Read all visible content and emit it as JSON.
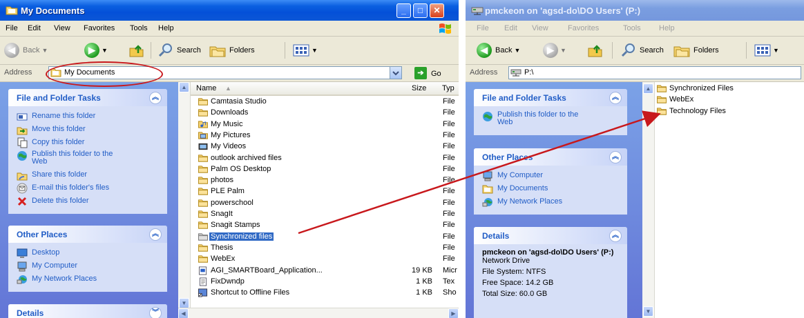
{
  "left_window": {
    "title": "My Documents",
    "menu": [
      "File",
      "Edit",
      "View",
      "Favorites",
      "Tools",
      "Help"
    ],
    "toolbar": {
      "back": "Back",
      "search": "Search",
      "folders": "Folders"
    },
    "address_label": "Address",
    "address_value": "My Documents",
    "go_label": "Go",
    "tasks_title": "File and Folder Tasks",
    "tasks": [
      {
        "label": "Rename this folder",
        "icon": "rename-icon"
      },
      {
        "label": "Move this folder",
        "icon": "move-icon"
      },
      {
        "label": "Copy this folder",
        "icon": "copy-icon"
      },
      {
        "label": "Publish this folder to the Web",
        "icon": "publish-web-icon"
      },
      {
        "label": "Share this folder",
        "icon": "share-icon"
      },
      {
        "label": "E-mail this folder's files",
        "icon": "email-icon"
      },
      {
        "label": "Delete this folder",
        "icon": "delete-icon"
      }
    ],
    "other_title": "Other Places",
    "other": [
      {
        "label": "Desktop",
        "icon": "desktop-icon"
      },
      {
        "label": "My Computer",
        "icon": "my-computer-icon"
      },
      {
        "label": "My Network Places",
        "icon": "network-places-icon"
      }
    ],
    "details_title": "Details",
    "columns": {
      "name": "Name",
      "size": "Size",
      "type": "Typ"
    },
    "files": [
      {
        "name": "Camtasia Studio",
        "size": "",
        "type": "File",
        "icon": "folder"
      },
      {
        "name": "Downloads",
        "size": "",
        "type": "File",
        "icon": "folder"
      },
      {
        "name": "My Music",
        "size": "",
        "type": "File",
        "icon": "music-folder"
      },
      {
        "name": "My Pictures",
        "size": "",
        "type": "File",
        "icon": "pictures-folder"
      },
      {
        "name": "My Videos",
        "size": "",
        "type": "File",
        "icon": "videos-folder"
      },
      {
        "name": "outlook archived files",
        "size": "",
        "type": "File",
        "icon": "folder"
      },
      {
        "name": "Palm OS Desktop",
        "size": "",
        "type": "File",
        "icon": "folder"
      },
      {
        "name": "photos",
        "size": "",
        "type": "File",
        "icon": "folder"
      },
      {
        "name": "PLE Palm",
        "size": "",
        "type": "File",
        "icon": "folder"
      },
      {
        "name": "powerschool",
        "size": "",
        "type": "File",
        "icon": "folder"
      },
      {
        "name": "SnagIt",
        "size": "",
        "type": "File",
        "icon": "folder"
      },
      {
        "name": "Snagit Stamps",
        "size": "",
        "type": "File",
        "icon": "folder"
      },
      {
        "name": "Synchronized files",
        "size": "",
        "type": "File",
        "icon": "sync-folder",
        "selected": true
      },
      {
        "name": "Thesis",
        "size": "",
        "type": "File",
        "icon": "folder"
      },
      {
        "name": "WebEx",
        "size": "",
        "type": "File",
        "icon": "folder"
      },
      {
        "name": "AGI_SMARTBoard_Application...",
        "size": "19 KB",
        "type": "Micr",
        "icon": "document"
      },
      {
        "name": "FixDwndp",
        "size": "1 KB",
        "type": "Tex",
        "icon": "text-file"
      },
      {
        "name": "Shortcut to Offline Files",
        "size": "1 KB",
        "type": "Sho",
        "icon": "shortcut"
      }
    ]
  },
  "right_window": {
    "title": "pmckeon on 'agsd-do\\DO Users' (P:)",
    "menu": [
      "File",
      "Edit",
      "View",
      "Favorites",
      "Tools",
      "Help"
    ],
    "toolbar": {
      "back": "Back",
      "search": "Search",
      "folders": "Folders"
    },
    "address_label": "Address",
    "address_value": "P:\\",
    "tasks_title": "File and Folder Tasks",
    "tasks": [
      {
        "label": "Publish this folder to the Web",
        "icon": "publish-web-icon"
      }
    ],
    "other_title": "Other Places",
    "other": [
      {
        "label": "My Computer",
        "icon": "my-computer-icon"
      },
      {
        "label": "My Documents",
        "icon": "my-documents-icon"
      },
      {
        "label": "My Network Places",
        "icon": "network-places-icon"
      }
    ],
    "details_title": "Details",
    "details": {
      "name": "pmckeon on 'agsd-do\\DO Users' (P:)",
      "kind": "Network Drive",
      "fs": "File System: NTFS",
      "free": "Free Space: 14.2 GB",
      "total": "Total Size: 60.0 GB"
    },
    "files": [
      {
        "name": "Synchronized Files",
        "icon": "folder"
      },
      {
        "name": "WebEx",
        "icon": "folder"
      },
      {
        "name": "Technology Files",
        "icon": "folder"
      }
    ]
  },
  "colors": {
    "annotation_red": "#c8181c",
    "link_blue": "#215dc6",
    "selection": "#316ac5"
  }
}
